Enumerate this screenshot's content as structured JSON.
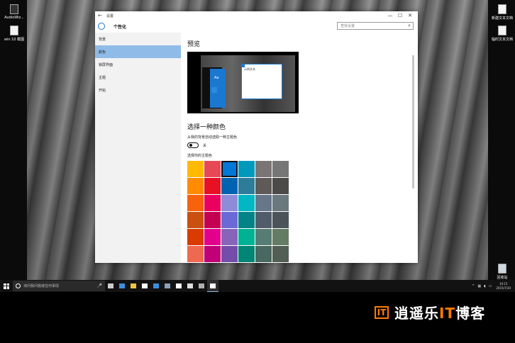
{
  "desktop": {
    "icons_left": [
      {
        "label": "AudioWiz..."
      },
      {
        "label": "win 10 截图"
      }
    ],
    "icons_right": [
      {
        "label": "新建文本文档"
      },
      {
        "label": "临时文本文档"
      },
      {
        "label": "回收站"
      }
    ]
  },
  "window": {
    "title": "设置",
    "back_glyph": "←",
    "controls": [
      "—",
      "☐",
      "✕"
    ],
    "header_title": "个性化",
    "search_placeholder": "查找设置",
    "sidebar": [
      {
        "label": "背景",
        "active": false
      },
      {
        "label": "颜色",
        "active": true
      },
      {
        "label": "锁屏界面",
        "active": false
      },
      {
        "label": "主题",
        "active": false
      },
      {
        "label": "开始",
        "active": false
      }
    ],
    "content": {
      "preview_heading": "预览",
      "preview_aa": "Aa",
      "preview_sample_text": "示例文本",
      "choose_heading": "选择一种颜色",
      "auto_pick_label": "从我的背景自动选取一种主题色",
      "toggle_state": "关",
      "accent_label": "选择你的主题色",
      "swatches": [
        "#ffb900",
        "#e74856",
        "#0078d7",
        "#0099bc",
        "#7a7574",
        "#767676",
        "#ff8c00",
        "#e81123",
        "#0063b1",
        "#2d7d9a",
        "#5d5a58",
        "#4c4a48",
        "#f7630c",
        "#ea005e",
        "#8e8cd8",
        "#00b7c3",
        "#68768a",
        "#69797e",
        "#ca5010",
        "#c30052",
        "#6b69d6",
        "#038387",
        "#515c6b",
        "#4a5459",
        "#da3b01",
        "#e3008c",
        "#8764b8",
        "#00b294",
        "#567c73",
        "#647c64",
        "#ef6950",
        "#bf0077",
        "#744da9",
        "#018574",
        "#486860",
        "#525e54"
      ],
      "selected_swatch": 2
    }
  },
  "taskbar": {
    "search_placeholder": "询问我问题或任何事情",
    "mic": "🎤",
    "icons": [
      {
        "name": "task-view",
        "color": "#cccccc"
      },
      {
        "name": "edge",
        "color": "#3a8fe0"
      },
      {
        "name": "file-explorer",
        "color": "#f3c342"
      },
      {
        "name": "store",
        "color": "#ffffff"
      },
      {
        "name": "photos",
        "color": "#3a8fe0"
      },
      {
        "name": "app",
        "color": "#8aa0b8"
      },
      {
        "name": "app",
        "color": "#ffffff"
      },
      {
        "name": "photos",
        "color": "#dddddd"
      },
      {
        "name": "app",
        "color": "#b0b0b0"
      },
      {
        "name": "settings",
        "color": "#ffffff"
      }
    ],
    "time": "10:15",
    "date": "2015/7/30"
  },
  "watermark": {
    "logo_mark": "IT",
    "text_pre": "逍遥乐",
    "text_it": "IT",
    "text_post": "博客"
  },
  "colors": {
    "accent": "#0078d7",
    "sidebar_selected": "#8fbbe8",
    "watermark_orange": "#ff7a00"
  }
}
